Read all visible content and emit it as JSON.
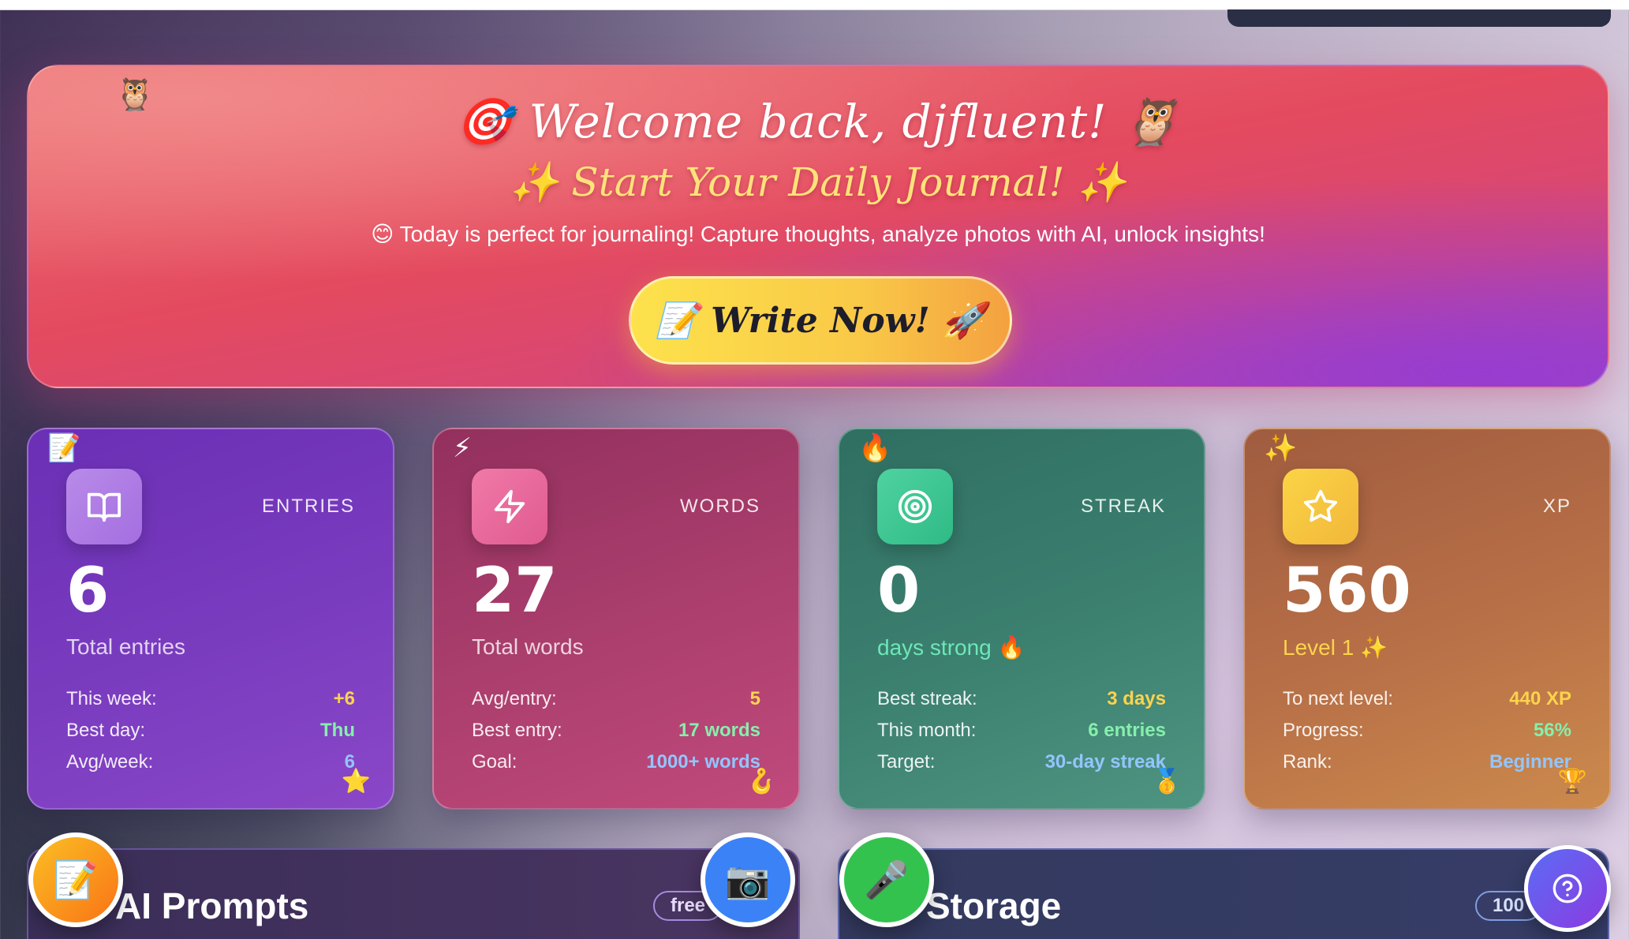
{
  "hero": {
    "title": "🎯 Welcome back, djfluent! 🦉",
    "subtitle": "✨ Start Your Daily Journal! ✨",
    "tagline": "😊 Today is perfect for journaling! Capture thoughts, analyze photos with AI, unlock insights!",
    "cta_label": "📝 Write Now! 🚀",
    "owl_emoji": "🦉"
  },
  "stats": {
    "entries": {
      "label": "ENTRIES",
      "value": "6",
      "caption": "Total entries",
      "deco_top": "📝",
      "deco_bottom": "⭐",
      "rows": [
        {
          "key": "This week:",
          "value": "+6"
        },
        {
          "key": "Best day:",
          "value": "Thu"
        },
        {
          "key": "Avg/week:",
          "value": "6"
        }
      ]
    },
    "words": {
      "label": "WORDS",
      "value": "27",
      "caption": "Total words",
      "deco_top": "⚡",
      "deco_bottom": "🪝",
      "rows": [
        {
          "key": "Avg/entry:",
          "value": "5"
        },
        {
          "key": "Best entry:",
          "value": "17 words"
        },
        {
          "key": "Goal:",
          "value": "1000+ words"
        }
      ]
    },
    "streak": {
      "label": "STREAK",
      "value": "0",
      "caption": "days strong 🔥",
      "deco_top": "🔥",
      "deco_bottom": "🥇",
      "rows": [
        {
          "key": "Best streak:",
          "value": "3 days"
        },
        {
          "key": "This month:",
          "value": "6 entries"
        },
        {
          "key": "Target:",
          "value": "30-day streak"
        }
      ]
    },
    "xp": {
      "label": "XP",
      "value": "560",
      "caption": "Level 1 ✨",
      "deco_top": "✨",
      "deco_bottom": "🏆",
      "rows": [
        {
          "key": "To next level:",
          "value": "440 XP"
        },
        {
          "key": "Progress:",
          "value": "56%"
        },
        {
          "key": "Rank:",
          "value": "Beginner"
        }
      ]
    }
  },
  "panels": {
    "prompts": {
      "title": "AI Prompts",
      "pill": "free"
    },
    "storage": {
      "title": "Storage",
      "pill": "100"
    }
  },
  "floating_buttons": {
    "write": "📝",
    "camera": "📷",
    "mic": "🎤"
  },
  "colors": {
    "hero_start": "#ec7273",
    "hero_end": "#a447b8",
    "cta_start": "#fde24c",
    "cta_end": "#f4a140"
  }
}
